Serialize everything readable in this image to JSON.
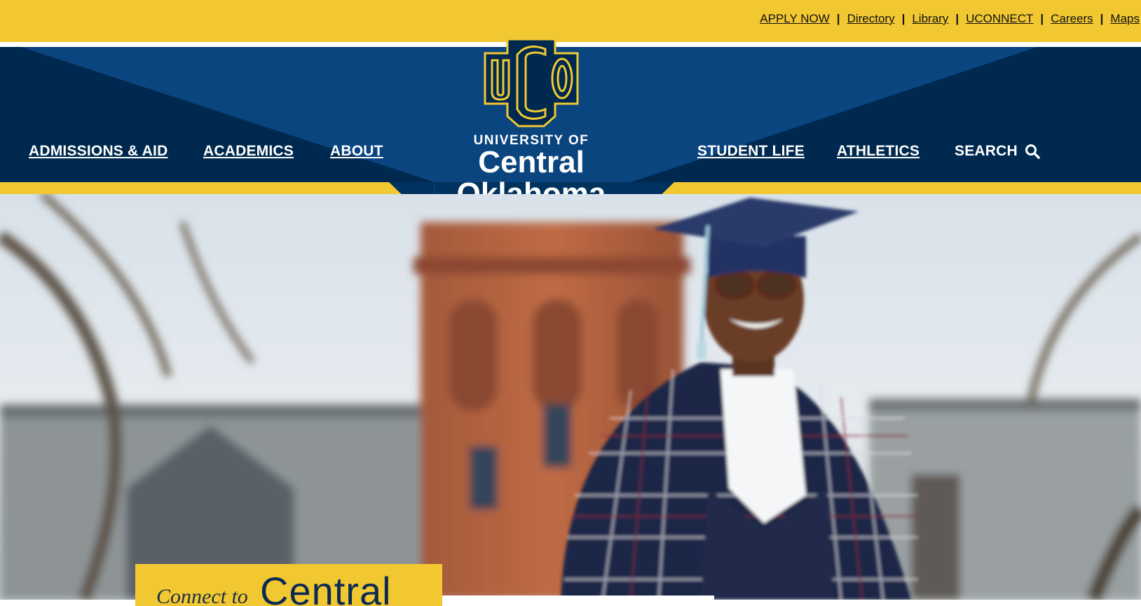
{
  "utility_nav": {
    "links": [
      "APPLY NOW",
      "Directory",
      "Library",
      "UCONNECT",
      "Careers",
      "Maps"
    ]
  },
  "main_nav": {
    "left": [
      "ADMISSIONS & AID",
      "ACADEMICS",
      "ABOUT"
    ],
    "right": [
      "STUDENT LIFE",
      "ATHLETICS"
    ],
    "search_label": "SEARCH"
  },
  "logo": {
    "monogram": "UCO",
    "line1": "UNIVERSITY OF",
    "line2": "Central",
    "line3": "Oklahoma"
  },
  "hero": {
    "caption_small": "Connect to",
    "caption_big": "Central"
  },
  "icons": {
    "search": "search-icon",
    "logo": "uco-monogram-icon"
  },
  "colors": {
    "gold": "#f1c832",
    "navy": "#00294f",
    "navy_light": "#0b4580"
  }
}
